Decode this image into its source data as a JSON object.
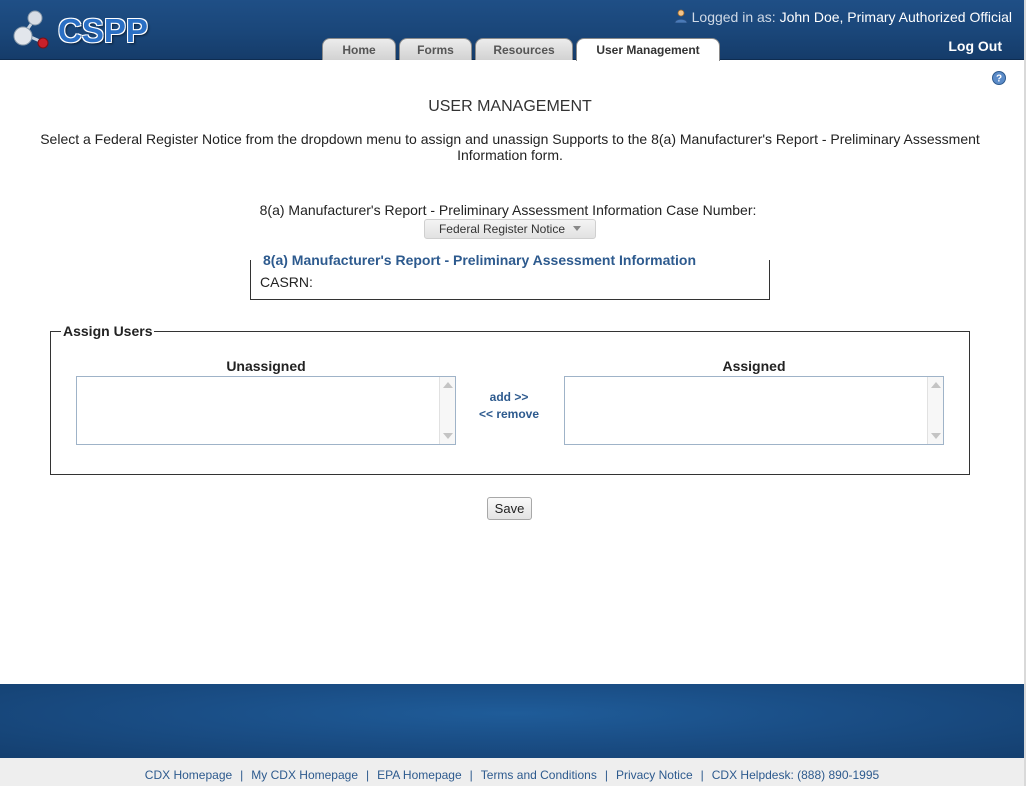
{
  "header": {
    "logo_text": "CSPP",
    "logged_in_label": "Logged in as:",
    "user_name": "John Doe, Primary Authorized Official",
    "logout_label": "Log Out",
    "tabs": [
      {
        "label": "Home"
      },
      {
        "label": "Forms"
      },
      {
        "label": "Resources"
      },
      {
        "label": "User Management",
        "active": true
      }
    ]
  },
  "main": {
    "title": "USER MANAGEMENT",
    "instructions": "Select a Federal Register Notice from the dropdown menu to assign and unassign Supports to the 8(a) Manufacturer's Report - Preliminary Assessment Information form.",
    "case_line": "8(a) Manufacturer's Report - Preliminary Assessment Information  Case Number:",
    "dropdown_value": "Federal Register Notice",
    "info": {
      "title": "8(a) Manufacturer's Report - Preliminary Assessment Information",
      "casrn_label": "CASRN:"
    },
    "assign": {
      "legend": "Assign Users",
      "unassigned_label": "Unassigned",
      "assigned_label": "Assigned",
      "add_label": "add >>",
      "remove_label": "<< remove"
    },
    "save_label": "Save"
  },
  "footer": {
    "links": [
      "CDX Homepage",
      "My CDX Homepage",
      "EPA Homepage",
      "Terms and Conditions",
      "Privacy Notice",
      "CDX Helpdesk: (888) 890-1995"
    ]
  },
  "colors": {
    "header_blue": "#1a4679",
    "link_blue": "#2d5a8e",
    "logo_blue": "#2a6fc4"
  },
  "icons": {
    "logo": "molecule-logo-icon",
    "user": "user-icon",
    "help": "help-icon"
  }
}
